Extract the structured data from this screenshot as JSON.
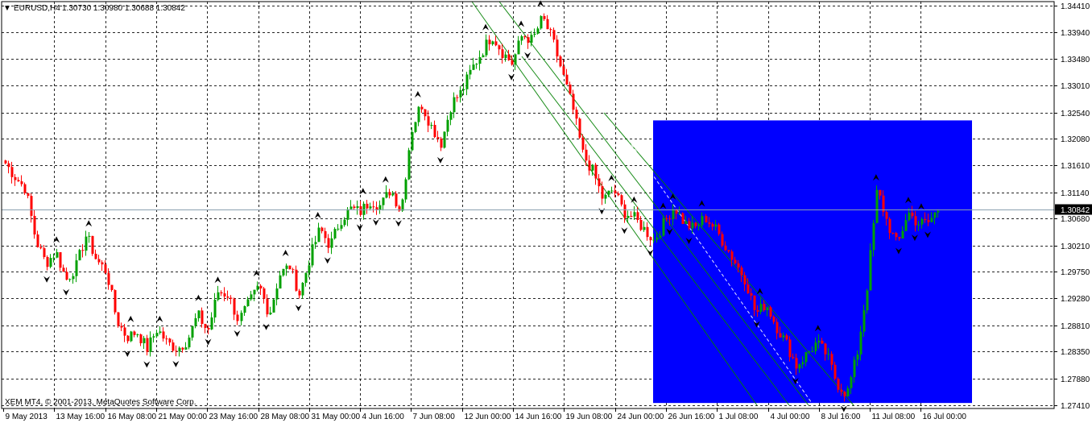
{
  "header": {
    "arrow_glyph": "▼",
    "symbol": "EURUSD,H4",
    "ohlc": "1.30730 1.30980 1.30688 1.30842"
  },
  "footer": {
    "copyright": "XEM MT4, © 2001-2013, MetaQuotes Software Corp."
  },
  "chart_data": {
    "type": "candlestick",
    "symbol": "EURUSD",
    "timeframe": "H4",
    "current_price": 1.30842,
    "current_price_label": "1.30842",
    "ylim": [
      1.2726,
      1.3449
    ],
    "y_ticks": [
      "1.34410",
      "1.33940",
      "1.33480",
      "1.33010",
      "1.32540",
      "1.32080",
      "1.31610",
      "1.31140",
      "1.30680",
      "1.30210",
      "1.29750",
      "1.29280",
      "1.28810",
      "1.28350",
      "1.27880",
      "1.27410"
    ],
    "x_ticks": [
      "9 May 2013",
      "13 May 16:00",
      "16 May 08:00",
      "21 May 00:00",
      "23 May 16:00",
      "28 May 08:00",
      "31 May 00:00",
      "4 Jun 16:00",
      "7 Jun 08:00",
      "12 Jun 00:00",
      "14 Jun 16:00",
      "19 Jun 08:00",
      "24 Jun 00:00",
      "26 Jun 16:00",
      "1 Jul 08:00",
      "4 Jul 00:00",
      "8 Jul 16:00",
      "11 Jul 08:00",
      "16 Jul 00:00"
    ],
    "bull_color": "#00a000",
    "bear_color": "#ff0000",
    "highlight_color": "#0000ff",
    "grid": "dashed",
    "close_path": [
      1.3165,
      1.314,
      1.312,
      1.303,
      1.299,
      1.301,
      1.296,
      1.2985,
      1.304,
      1.2995,
      1.2975,
      1.289,
      1.286,
      1.287,
      1.284,
      1.2875,
      1.285,
      1.284,
      1.2855,
      1.29,
      1.287,
      1.294,
      1.2935,
      1.289,
      1.292,
      1.295,
      1.29,
      1.297,
      1.2985,
      1.2935,
      1.3,
      1.305,
      1.302,
      1.3065,
      1.3085,
      1.308,
      1.31,
      1.309,
      1.312,
      1.308,
      1.322,
      1.327,
      1.323,
      1.32,
      1.327,
      1.329,
      1.333,
      1.336,
      1.339,
      1.336,
      1.334,
      1.339,
      1.338,
      1.342,
      1.338,
      1.332,
      1.326,
      1.318,
      1.315,
      1.31,
      1.312,
      1.308,
      1.307,
      1.305,
      1.303,
      1.306,
      1.309,
      1.306,
      1.305,
      1.307,
      1.305,
      1.302,
      1.299,
      1.296,
      1.29,
      1.292,
      1.288,
      1.285,
      1.281,
      1.283,
      1.285,
      1.283,
      1.278,
      1.276,
      1.283,
      1.295,
      1.312,
      1.306,
      1.302,
      1.308,
      1.306,
      1.306,
      1.3084
    ],
    "highlight_region": {
      "x_start": "24 Jun 08:00",
      "x_end": "16 Jul 12:00",
      "y_range": [
        1.2745,
        1.324
      ]
    },
    "fractal_markers": "up and down arrow markers above highs and below lows",
    "channel_lines": "descending parallel channel from 12 Jun to 8 Jul"
  }
}
